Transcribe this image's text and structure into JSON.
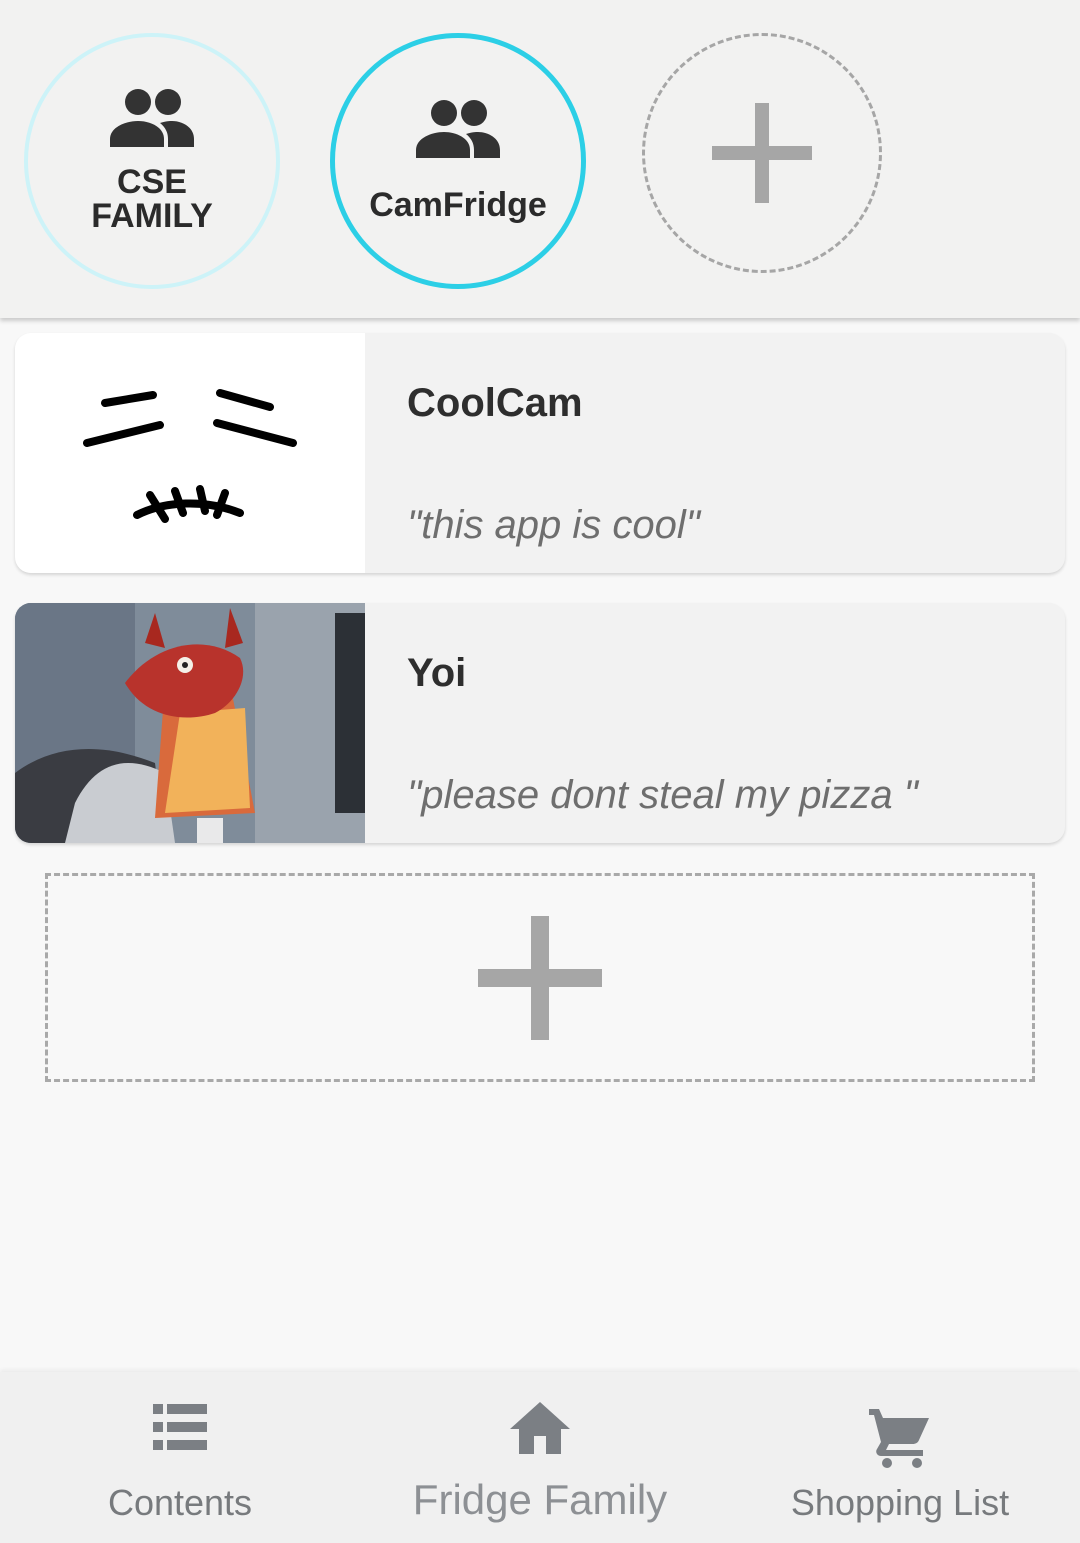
{
  "families": [
    {
      "label": "CSE\nFAMILY",
      "icon": "group-icon",
      "selected": false
    },
    {
      "label": "CamFridge",
      "icon": "group-icon",
      "selected": true
    }
  ],
  "add_family_icon": "plus-icon",
  "cameras": [
    {
      "name": "CoolCam",
      "quote": "\"this app is cool\"",
      "thumbnail": "face-doodle"
    },
    {
      "name": "Yoi",
      "quote": "\"please dont steal my pizza \"",
      "thumbnail": "dragon-photo"
    }
  ],
  "add_camera_icon": "plus-icon",
  "nav": {
    "contents": {
      "label": "Contents",
      "icon": "list-icon"
    },
    "family": {
      "label": "Fridge Family",
      "icon": "home-icon"
    },
    "shopping": {
      "label": "Shopping List",
      "icon": "cart-icon"
    }
  },
  "colors": {
    "accent": "#2ccfe6",
    "accent_light": "#cdf3f8",
    "icon_dark": "#333333",
    "nav_icon": "#7b7f84",
    "dashed": "#a6a6a6"
  }
}
